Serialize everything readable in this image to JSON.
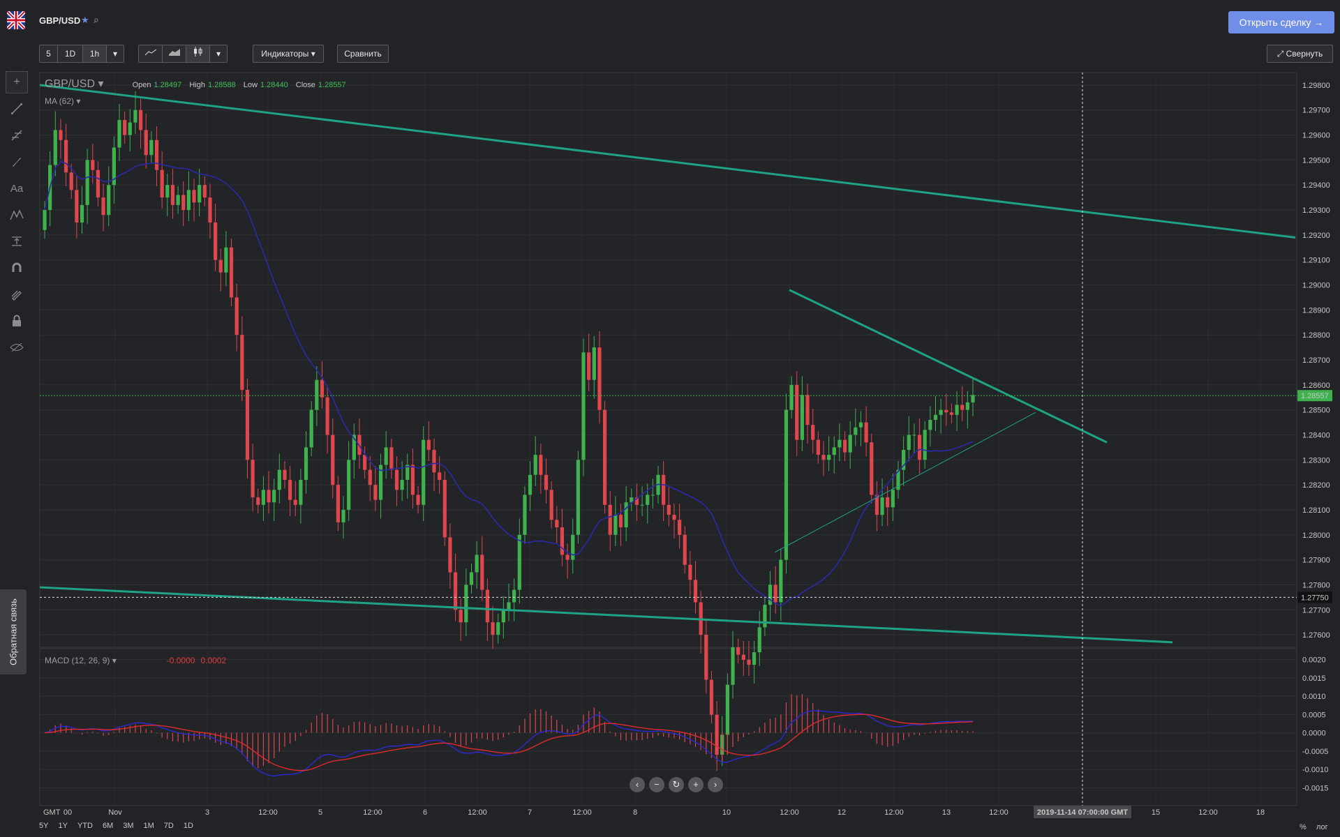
{
  "header": {
    "symbol": "GBP/USD",
    "open_deal_label": "Открыть сделку →"
  },
  "toolbar": {
    "intervals": [
      "5",
      "1D",
      "1h"
    ],
    "indicators_label": "Индикаторы ▾",
    "compare_label": "Сравнить",
    "collapse_label": "⤢ Свернуть"
  },
  "feedback_label": "Обратная связь",
  "legend": {
    "pair": "GBP/USD ▾",
    "open_label": "Open",
    "open": "1.28497",
    "high_label": "High",
    "high": "1.28588",
    "low_label": "Low",
    "low": "1.28440",
    "close_label": "Close",
    "close": "1.28557",
    "ma_label": "MA (62) ▾",
    "macd_label": "MACD (12, 26, 9) ▾",
    "macd_value": "-0.0000",
    "macd_signal": "0.0002"
  },
  "colors": {
    "up": "#3fb24e",
    "down": "#e0474c",
    "ma": "#2a2aa8",
    "trend": "#1fa385",
    "price_tag": "#3fb24e",
    "accent": "#6f8ee8"
  },
  "chart_data": {
    "type": "candlestick",
    "symbol": "GBP/USD",
    "interval": "1h",
    "ylim": [
      1.2755,
      1.2985
    ],
    "y_ticks": [
      "1.29800",
      "1.29700",
      "1.29600",
      "1.29500",
      "1.29400",
      "1.29300",
      "1.29200",
      "1.29100",
      "1.29000",
      "1.28900",
      "1.28800",
      "1.28700",
      "1.28600",
      "1.28500",
      "1.28400",
      "1.28300",
      "1.28200",
      "1.28100",
      "1.28000",
      "1.27900",
      "1.27800",
      "1.27700",
      "1.27600"
    ],
    "current_price": "1.28557",
    "crosshair_price": "1.27750",
    "crosshair_time": "2019-11-14 07:00:00 GMT",
    "x_ticks": [
      "GMT",
      "00",
      "Nov",
      "3",
      "12:00",
      "5",
      "12:00",
      "6",
      "12:00",
      "7",
      "12:00",
      "8",
      "10",
      "12:00",
      "12",
      "12:00",
      "13",
      "12:00",
      "15",
      "12:00",
      "18"
    ],
    "closes": [
      1.293,
      1.2948,
      1.2962,
      1.2958,
      1.2945,
      1.2938,
      1.2925,
      1.2932,
      1.295,
      1.2946,
      1.2935,
      1.2928,
      1.294,
      1.2955,
      1.2966,
      1.296,
      1.2965,
      1.297,
      1.2962,
      1.2952,
      1.2958,
      1.2946,
      1.2935,
      1.294,
      1.2932,
      1.2936,
      1.293,
      1.2938,
      1.2933,
      1.294,
      1.2935,
      1.2925,
      1.291,
      1.2905,
      1.2915,
      1.2895,
      1.288,
      1.2858,
      1.283,
      1.2815,
      1.2812,
      1.2818,
      1.2813,
      1.2818,
      1.2826,
      1.2822,
      1.2814,
      1.2812,
      1.2822,
      1.2835,
      1.285,
      1.2862,
      1.2855,
      1.284,
      1.282,
      1.2805,
      1.281,
      1.283,
      1.284,
      1.2832,
      1.2826,
      1.282,
      1.2814,
      1.2828,
      1.2835,
      1.2826,
      1.2818,
      1.2822,
      1.2828,
      1.2816,
      1.2812,
      1.2838,
      1.2834,
      1.2825,
      1.2822,
      1.2799,
      1.2785,
      1.277,
      1.2765,
      1.278,
      1.2785,
      1.2792,
      1.2778,
      1.2765,
      1.276,
      1.2765,
      1.277,
      1.2773,
      1.2778,
      1.28,
      1.2816,
      1.2824,
      1.2832,
      1.2824,
      1.2818,
      1.2806,
      1.2803,
      1.2792,
      1.279,
      1.28,
      1.283,
      1.2873,
      1.2862,
      1.2875,
      1.285,
      1.2812,
      1.28,
      1.2808,
      1.2803,
      1.2813,
      1.2815,
      1.2812,
      1.2812,
      1.2816,
      1.2816,
      1.2824,
      1.2812,
      1.2808,
      1.2806,
      1.28,
      1.2788,
      1.2782,
      1.2773,
      1.276,
      1.2742,
      1.2728,
      1.2712,
      1.272,
      1.274,
      1.2755,
      1.2752,
      1.275,
      1.2748,
      1.2753,
      1.2763,
      1.2772,
      1.278,
      1.2773,
      1.279,
      1.285,
      1.286,
      1.2838,
      1.2856,
      1.2844,
      1.2838,
      1.2832,
      1.283,
      1.2832,
      1.2835,
      1.2838,
      1.2833,
      1.284,
      1.2843,
      1.2845,
      1.2837,
      1.2816,
      1.2808,
      1.2815,
      1.2811,
      1.2818,
      1.2826,
      1.2834,
      1.284,
      1.284,
      1.283,
      1.2842,
      1.2846,
      1.2848,
      1.285,
      1.2849,
      1.2848,
      1.2852,
      1.285,
      1.2853,
      1.2856
    ]
  }
}
